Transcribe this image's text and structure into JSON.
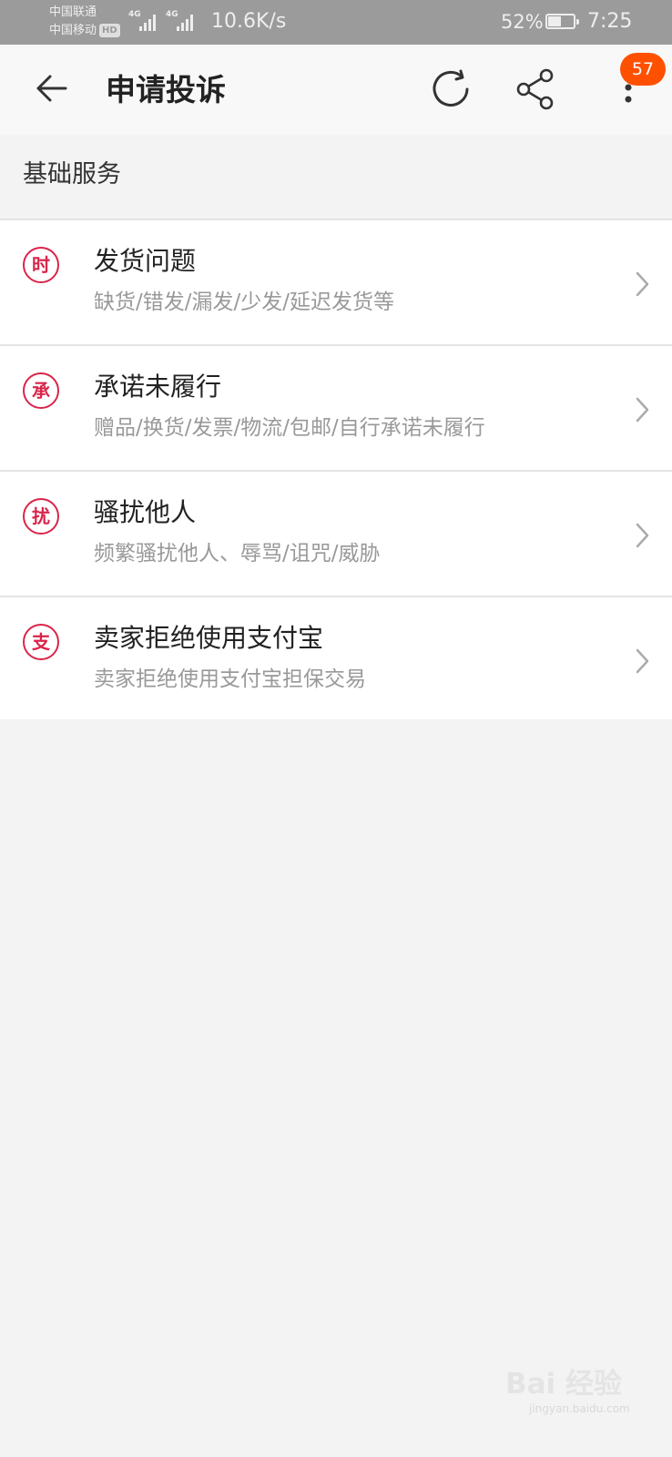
{
  "status_bar": {
    "carrier1": "中国联通",
    "carrier2": "中国移动",
    "hd_badge": "HD",
    "signal_label_1": "4G",
    "signal_label_2": "4G",
    "net_speed": "10.6K/s",
    "battery_percent": "52%",
    "battery_level": 0.52,
    "time": "7:25"
  },
  "app_bar": {
    "title": "申请投诉",
    "icons": [
      "back-arrow-icon",
      "refresh-icon",
      "share-icon",
      "more-vertical-icon"
    ],
    "notification_count": "57"
  },
  "section": {
    "title": "基础服务"
  },
  "items": [
    {
      "icon_char": "时",
      "title": "发货问题",
      "desc": "缺货/错发/漏发/少发/延迟发货等"
    },
    {
      "icon_char": "承",
      "title": "承诺未履行",
      "desc": "赠品/换货/发票/物流/包邮/自行承诺未履行"
    },
    {
      "icon_char": "扰",
      "title": "骚扰他人",
      "desc": "频繁骚扰他人、辱骂/诅咒/威胁"
    },
    {
      "icon_char": "支",
      "title": "卖家拒绝使用支付宝",
      "desc": "卖家拒绝使用支付宝担保交易"
    }
  ],
  "watermark": {
    "main": "Bai 经验",
    "sub": "jingyan.baidu.com"
  },
  "colors": {
    "accent": "#d9254a",
    "badge": "#ff5000",
    "background": "#f3f3f3",
    "status_bar": "#9b9b9b"
  }
}
